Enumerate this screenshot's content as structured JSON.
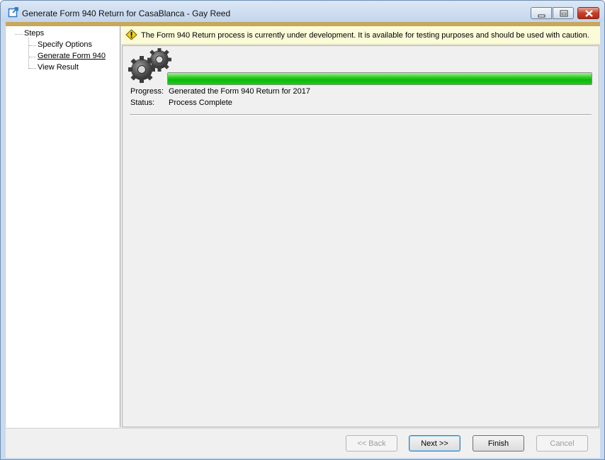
{
  "window": {
    "title": "Generate Form 940 Return for CasaBlanca - Gay Reed"
  },
  "steps": {
    "root_label": "Steps",
    "items": [
      {
        "label": "Specify Options",
        "current": false
      },
      {
        "label": "Generate Form 940",
        "current": true
      },
      {
        "label": "View Result",
        "current": false
      }
    ]
  },
  "banner": {
    "icon": "warning-icon",
    "text": "The Form 940 Return process is currently under development. It is available for testing purposes and should be used with caution."
  },
  "process": {
    "icon": "gears-icon",
    "progress_fraction": 1.0,
    "progress_label": "Progress:",
    "progress_value": "Generated the Form 940 Return for 2017",
    "status_label": "Status:",
    "status_value": "Process Complete"
  },
  "buttons": {
    "back": "<< Back",
    "next": "Next >>",
    "finish": "Finish",
    "cancel": "Cancel"
  },
  "colors": {
    "progress_green": "#0cb80c",
    "banner_bg": "#fcfbd8",
    "accent_bar": "#c6a85b"
  }
}
